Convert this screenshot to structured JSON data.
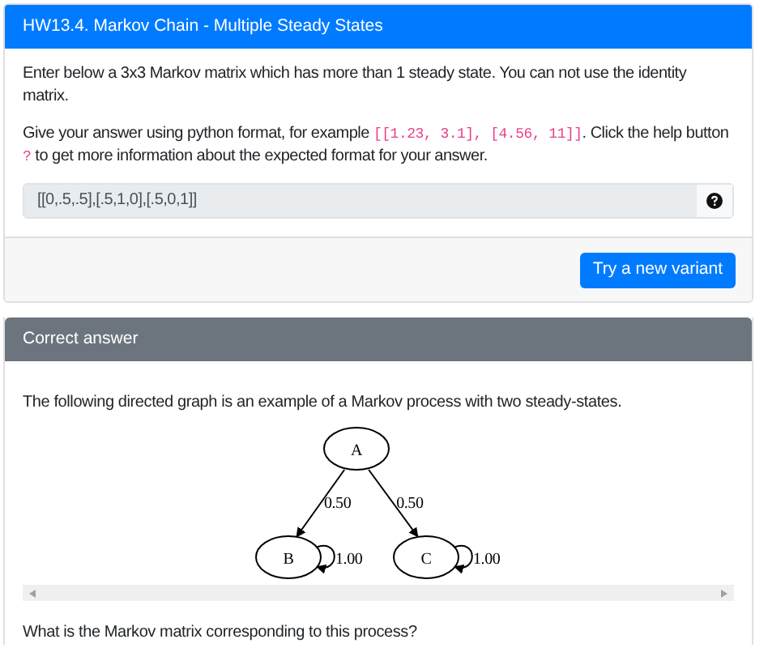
{
  "question_card": {
    "title": "HW13.4. Markov Chain - Multiple Steady States",
    "paragraphs": [
      "Enter below a 3x3 Markov matrix which has more than 1 steady state. You can not use the identity matrix."
    ],
    "format_hint": {
      "before": "Give your answer using python format, for example ",
      "code": "[[1.23, 3.1], [4.56, 11]]",
      "middle": ". Click the help button ",
      "help_mark": "?",
      "after": " to get more information about the expected format for your answer."
    },
    "answer_field": {
      "value": "[[0,.5,.5],[.5,1,0],[.5,0,1]]",
      "disabled": true
    },
    "button": "Try a new variant"
  },
  "answer_card": {
    "title": "Correct answer",
    "intro": "The following directed graph is an example of a Markov process with two steady-states.",
    "graph": {
      "nodes": [
        "A",
        "B",
        "C"
      ],
      "edges": [
        {
          "kind": "transition",
          "label": "0.50"
        },
        {
          "kind": "transition",
          "label": "0.50"
        },
        {
          "kind": "self_loop",
          "label": "1.00"
        },
        {
          "kind": "self_loop",
          "label": "1.00"
        }
      ]
    },
    "question": "What is the Markov matrix corresponding to this process?"
  }
}
